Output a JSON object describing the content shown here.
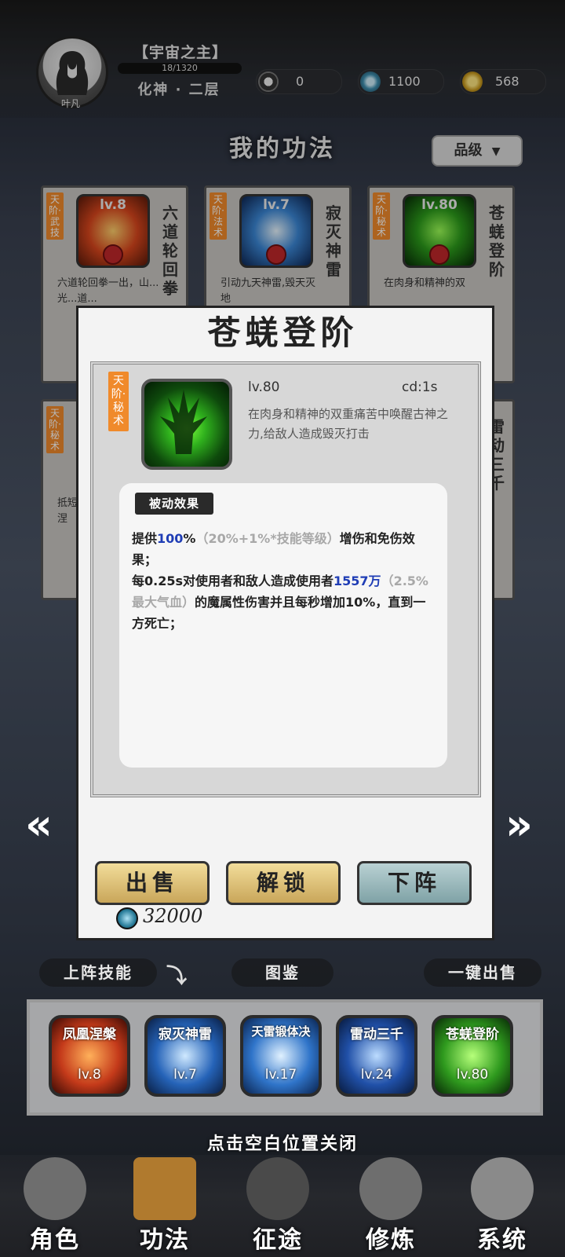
{
  "player": {
    "name": "叶凡",
    "title": "【宇宙之主】",
    "xp": "18/1320",
    "realm": "化神 · 二层"
  },
  "resources": [
    {
      "icon": "yin-yang-icon",
      "value": "0"
    },
    {
      "icon": "spirit-stone-icon",
      "value": "1100"
    },
    {
      "icon": "lightning-icon",
      "value": "568"
    }
  ],
  "page": {
    "heading": "我的功法",
    "grade_filter": "品级"
  },
  "background_cards": [
    {
      "tag": "天阶·武技",
      "level": "lv.8",
      "name": "六道轮回拳",
      "desc": "六道轮回拳一出，山...光...道..."
    },
    {
      "tag": "天阶·法术",
      "level": "lv.7",
      "name": "寂灭神雷",
      "desc": "引动九天神雷,毁天灭地"
    },
    {
      "tag": "天阶·秘术",
      "level": "lv.80",
      "name": "苍蜣登阶",
      "desc": "在肉身和精神的双"
    },
    {
      "tag": "天阶·秘术",
      "level": "",
      "name": "",
      "desc": "抵短复涅"
    },
    {
      "tag": "",
      "level": "",
      "name": "雷动三千",
      "desc": ""
    }
  ],
  "modal": {
    "title": "苍蜣登阶",
    "tag": "天阶·秘术",
    "level": "lv.80",
    "cd": "cd:1s",
    "description": "在肉身和精神的双重痛苦中唤醒古神之力,给敌人造成毁灭打击",
    "effect_header": "被动效果",
    "effect": {
      "p1_a": "提供",
      "p1_b": "100",
      "p1_c": "%",
      "p1_d": "（20%+1%*技能等级）",
      "p1_e": "增伤和免伤效果；",
      "p2_a": "每0.25s对使用者和敌人造成使用者",
      "p2_b": "1557万",
      "p2_c": "（2.5%最大气血）",
      "p2_d": "的魔属性伤害并且每秒增加10%，直到一方死亡；"
    },
    "buttons": {
      "sell": "出售",
      "unlock": "解锁",
      "unequip": "下阵"
    },
    "price": "32000"
  },
  "nav_arrows": {
    "prev": "«",
    "next": "»"
  },
  "sections": {
    "equipped": "上阵技能",
    "codex": "图鉴",
    "sell_all": "一键出售"
  },
  "equipped_skills": [
    {
      "name": "凤凰涅槃",
      "level": "lv.8",
      "color": "#c43a1a"
    },
    {
      "name": "寂灭神雷",
      "level": "lv.7",
      "color": "#2563b8"
    },
    {
      "name": "天雷锻体决",
      "level": "lv.17",
      "color": "#2f74c9"
    },
    {
      "name": "雷动三千",
      "level": "lv.24",
      "color": "#2050a8"
    },
    {
      "name": "苍蜣登阶",
      "level": "lv.80",
      "color": "#2f9a1e"
    }
  ],
  "close_hint": "点击空白位置关闭",
  "bottom_nav": [
    {
      "label": "角色",
      "icon": "character-icon"
    },
    {
      "label": "功法",
      "icon": "skill-book-icon"
    },
    {
      "label": "征途",
      "icon": "journey-icon"
    },
    {
      "label": "修炼",
      "icon": "cultivation-icon"
    },
    {
      "label": "系统",
      "icon": "system-icon"
    }
  ]
}
